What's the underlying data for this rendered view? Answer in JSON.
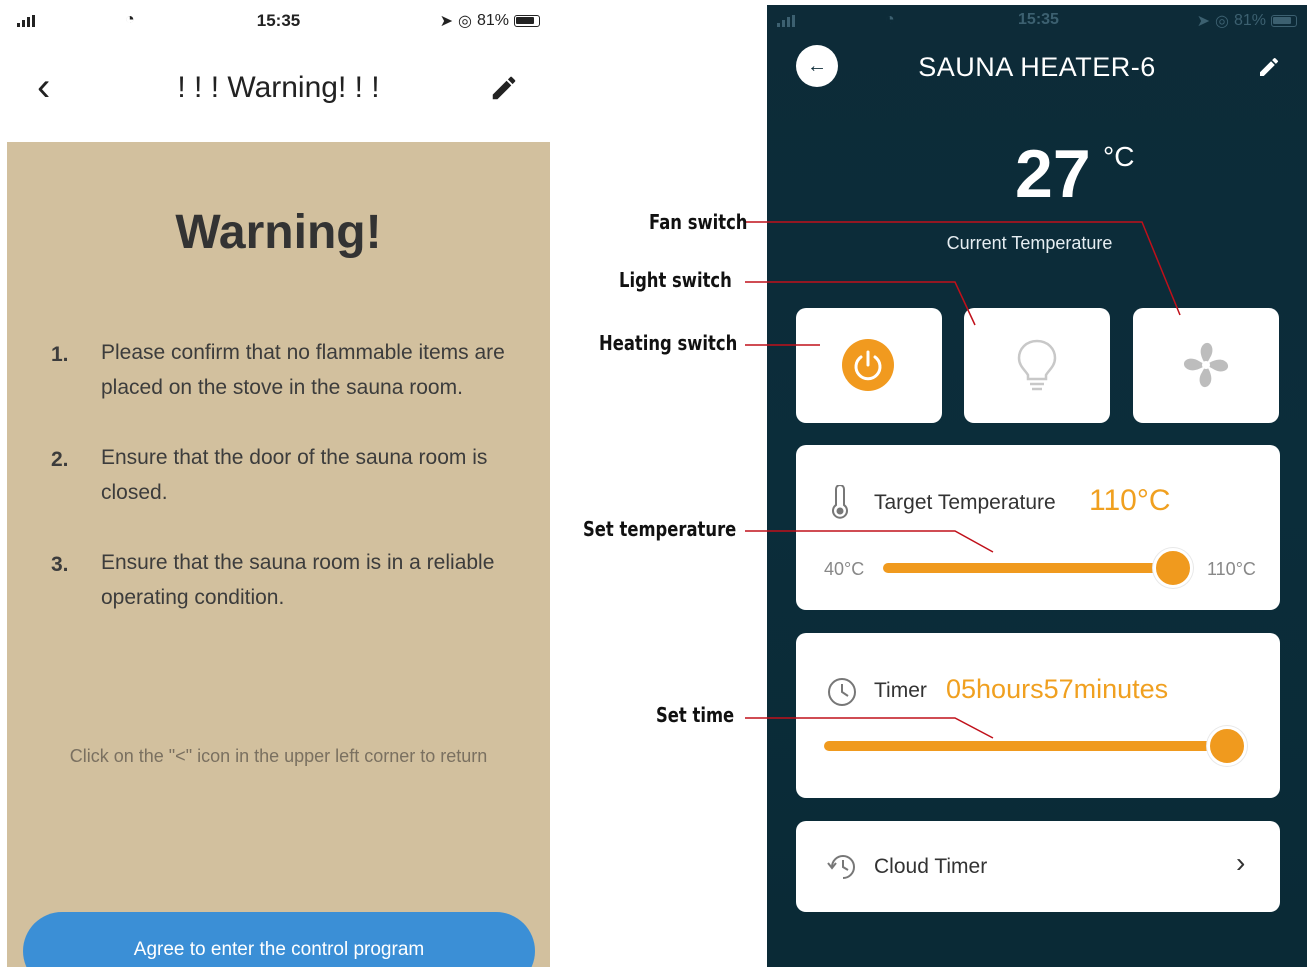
{
  "left_screen": {
    "status": {
      "time": "15:35",
      "battery": "81%"
    },
    "nav": {
      "title": "! ! ! Warning! ! !"
    },
    "heading": "Warning!",
    "items": [
      {
        "num": "1.",
        "text": "Please confirm that no flammable items are placed on the stove in the sauna room."
      },
      {
        "num": "2.",
        "text": "Ensure that the door of the sauna room is closed."
      },
      {
        "num": "3.",
        "text": "Ensure that the sauna room is in a reliable operating condition."
      }
    ],
    "hint": "Click on the \"<\" icon in the upper left corner to return",
    "agree_button": "Agree to enter the control program",
    "colors": {
      "background": "#d2c09e",
      "button": "#3b8fd6"
    }
  },
  "right_screen": {
    "status": {
      "time": "15:35",
      "battery": "81%"
    },
    "title": "SAUNA HEATER-6",
    "current_temperature": {
      "value": "27",
      "unit": "°C",
      "label": "Current Temperature"
    },
    "switches": [
      {
        "name": "heating",
        "icon": "power-icon",
        "active": true
      },
      {
        "name": "light",
        "icon": "bulb-icon",
        "active": false
      },
      {
        "name": "fan",
        "icon": "fan-icon",
        "active": false
      }
    ],
    "target": {
      "label": "Target Temperature",
      "value": "110°C",
      "min": "40°C",
      "max": "110°C",
      "level": 1.0
    },
    "timer": {
      "label": "Timer",
      "value": "05hours57minutes",
      "level": 1.0
    },
    "cloud_timer": {
      "label": "Cloud Timer"
    },
    "colors": {
      "background": "#0d2b38",
      "accent": "#f09a1e"
    }
  },
  "annotations": {
    "fan": "Fan switch",
    "light": "Light switch",
    "heating": "Heating switch",
    "set_temperature": "Set temperature",
    "set_time": "Set time"
  }
}
